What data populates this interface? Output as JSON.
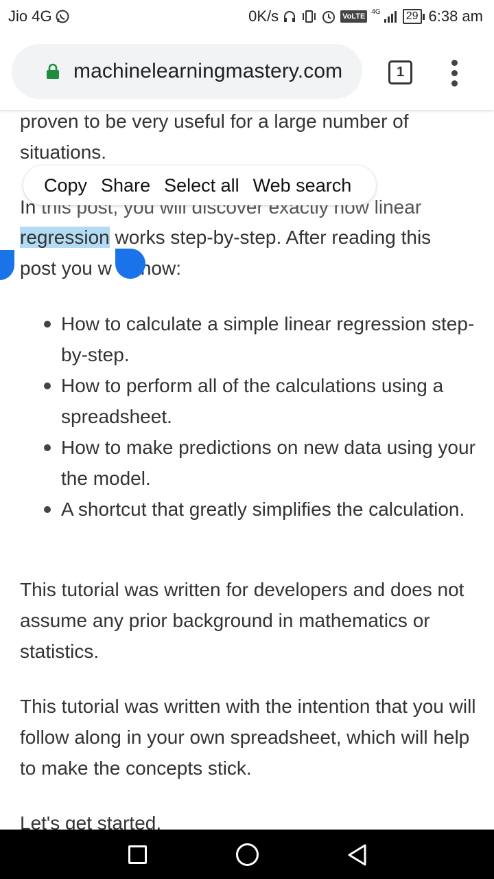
{
  "status_bar": {
    "carrier": "Jio 4G",
    "whatsapp_icon": "whatsapp-notification-icon",
    "speed": "0K/s",
    "volte": "VoLTE",
    "network": "4G",
    "battery": "29",
    "time": "6:38 am"
  },
  "browser": {
    "url": "machinelearningmastery.com",
    "tab_count": "1",
    "lock_color": "#1e8e3e"
  },
  "context_menu": {
    "items": [
      "Copy",
      "Share",
      "Select all",
      "Web search"
    ]
  },
  "article": {
    "line1": "proven to be very useful for a large number of",
    "line2": "situations.",
    "intro_partial": "In this post, you will discover exactly how linear",
    "intro_visible_tail": "ow linear",
    "intro_visible_head": "In",
    "selected_word": "regression",
    "intro_line2_rest": " works step-by-step. After reading this",
    "intro_line3_a": "post you w",
    "intro_line3_b": "know:",
    "bullets": [
      "How to calculate a simple linear regression step-by-step.",
      "How to perform all of the calculations using a spreadsheet.",
      "How to make predictions on new data using your the model.",
      "A shortcut that greatly simplifies the calculation."
    ],
    "para_dev": "This tutorial was written for developers and does not assume any prior background in mathematics or statistics.",
    "para_follow": "This tutorial was written with the intention that you will follow along in your own spreadsheet, which will help to make the concepts stick.",
    "para_start": "Let's get started."
  },
  "colors": {
    "selection_highlight": "#b3dcf4",
    "selection_handle": "#1a73e8"
  }
}
